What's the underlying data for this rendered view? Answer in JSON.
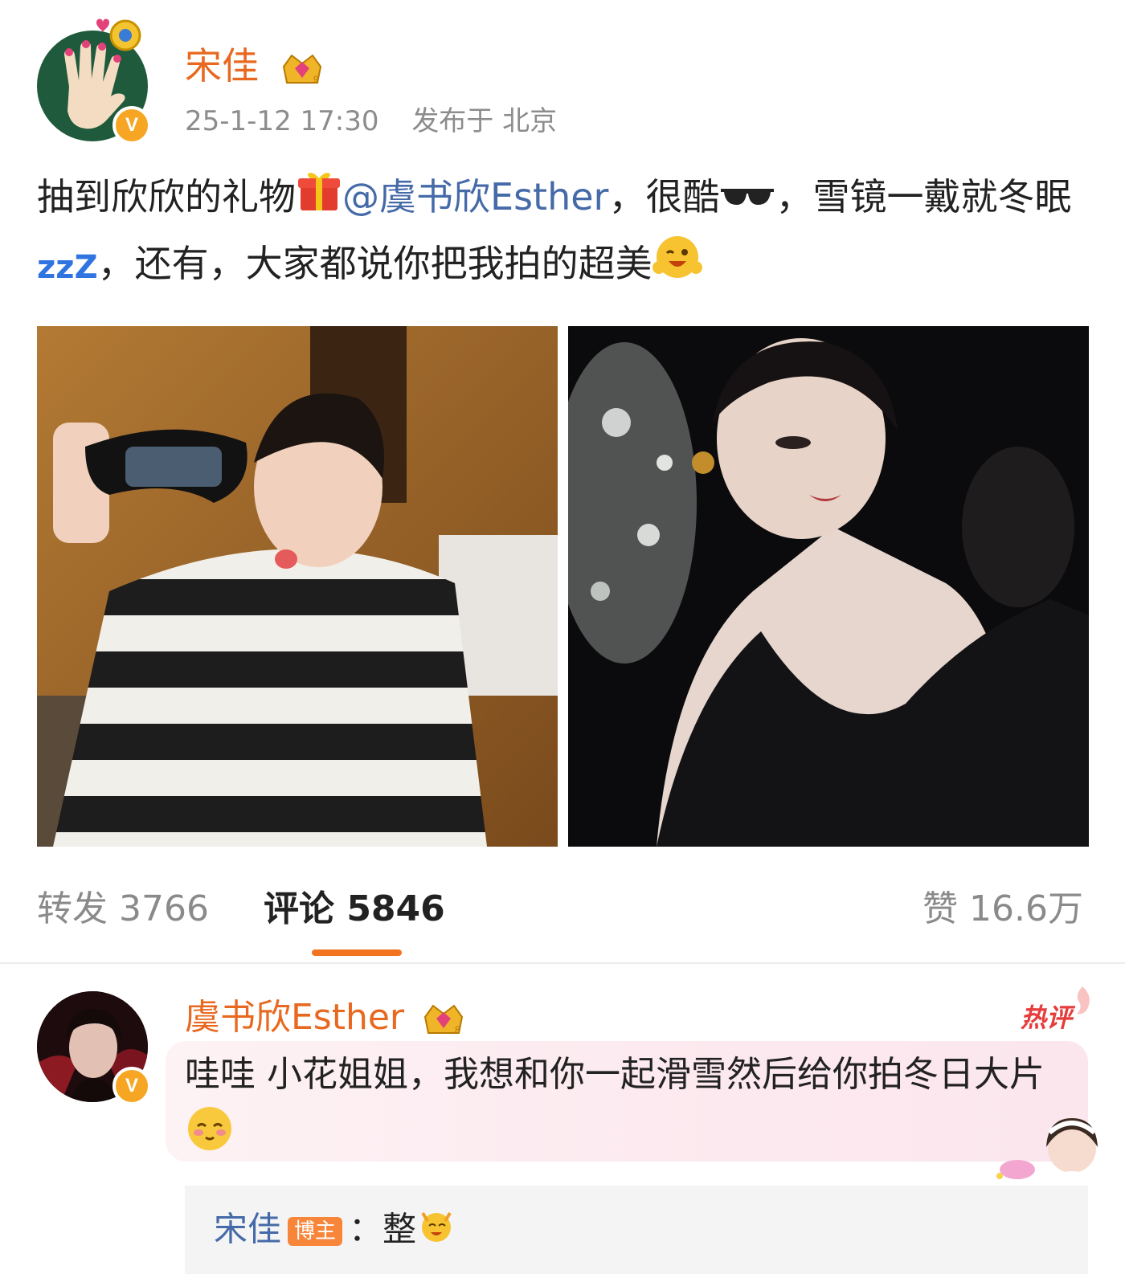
{
  "post": {
    "username": "宋佳",
    "timestamp": "25-1-12 17:30",
    "location": "发布于 北京",
    "text_part1": "抽到欣欣的礼物",
    "mention": "@虞书欣Esther",
    "text_part2": "，很酷",
    "text_part3": "，雪镜一戴就冬眠",
    "text_part4": "，还有，大家都说你把我拍的超美",
    "zzz": "zzZ"
  },
  "actions": {
    "repost_label": "转发 3766",
    "comment_label": "评论 5846",
    "like_label": "赞 16.6万"
  },
  "comment": {
    "username": "虞书欣Esther",
    "hot_tag": "热评",
    "text": "哇哇 小花姐姐，我想和你一起滑雪然后给你拍冬日大片",
    "reply_name": "宋佳",
    "reply_tag": "博主",
    "reply_text": "：整"
  },
  "colors": {
    "accent_orange": "#e8681f",
    "mention_blue": "#456aa8",
    "tab_underline": "#f27420",
    "hot_red": "#e63c3c"
  }
}
